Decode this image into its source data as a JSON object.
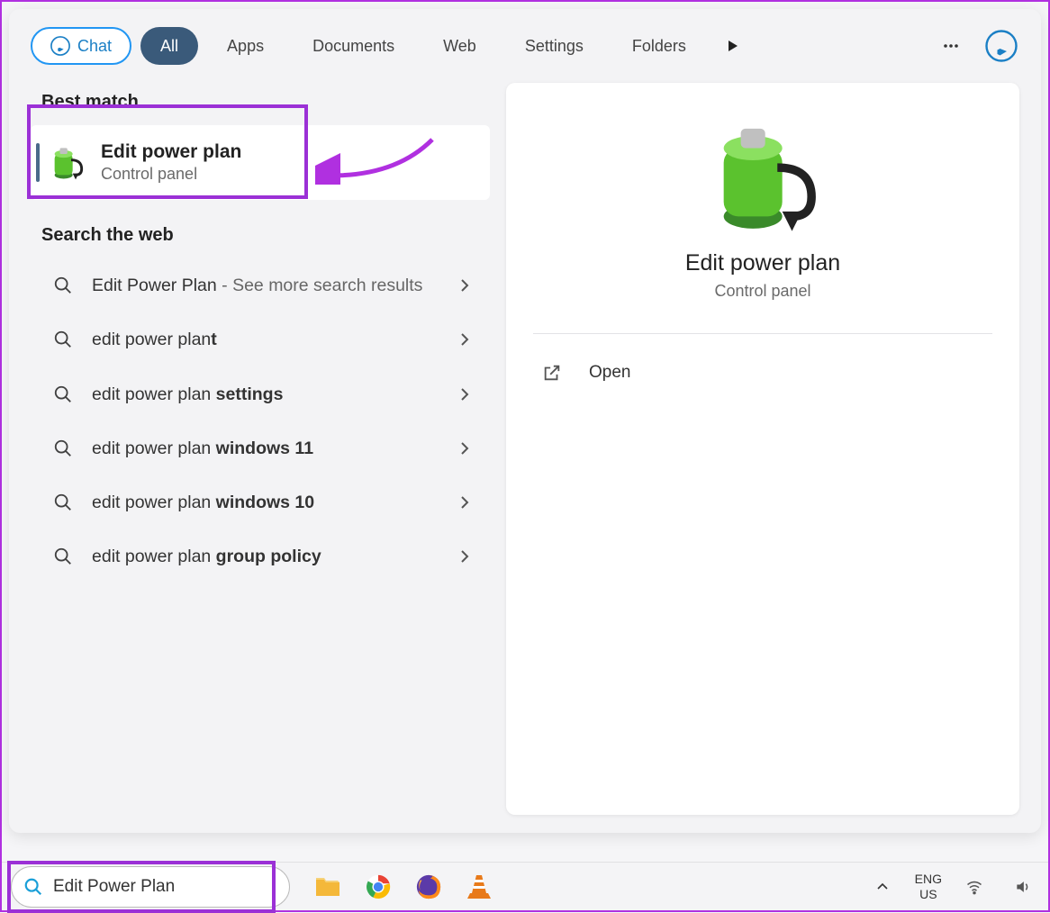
{
  "tabs": {
    "chat": "Chat",
    "all": "All",
    "apps": "Apps",
    "documents": "Documents",
    "web": "Web",
    "settings": "Settings",
    "folders": "Folders"
  },
  "sections": {
    "best_match": "Best match",
    "search_web": "Search the web"
  },
  "best_match": {
    "title": "Edit power plan",
    "subtitle": "Control panel"
  },
  "web_results": [
    {
      "prefix": "Edit Power Plan",
      "secondary": " - See more search results",
      "bold": ""
    },
    {
      "prefix": "edit power plan",
      "secondary": "",
      "bold": "t"
    },
    {
      "prefix": "edit power plan ",
      "secondary": "",
      "bold": "settings"
    },
    {
      "prefix": "edit power plan ",
      "secondary": "",
      "bold": "windows 11"
    },
    {
      "prefix": "edit power plan ",
      "secondary": "",
      "bold": "windows 10"
    },
    {
      "prefix": "edit power plan ",
      "secondary": "",
      "bold": "group policy"
    }
  ],
  "preview": {
    "title": "Edit power plan",
    "subtitle": "Control panel",
    "action": "Open"
  },
  "taskbar": {
    "search_value": "Edit Power Plan",
    "lang_line1": "ENG",
    "lang_line2": "US"
  }
}
